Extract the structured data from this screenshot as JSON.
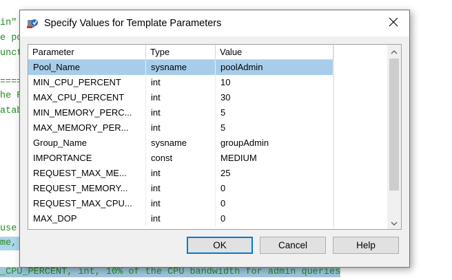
{
  "editor": {
    "lines": [
      {
        "text": "in\""
      },
      {
        "text": "e po"
      },
      {
        "text": "unct"
      },
      {
        "text": ""
      },
      {
        "text": "===="
      },
      {
        "text": "he R"
      },
      {
        "text": "atab"
      },
      {
        "text": "use"
      },
      {
        "text": "me,"
      },
      {
        "text": "_CPU_PERCENT, int, 10% of the CPU bandwidth for admin queries"
      }
    ]
  },
  "dialog": {
    "title": "Specify Values for Template Parameters",
    "columns": [
      "Parameter",
      "Type",
      "Value"
    ],
    "rows": [
      {
        "parameter": "Pool_Name",
        "type": "sysname",
        "value": "poolAdmin"
      },
      {
        "parameter": "MIN_CPU_PERCENT",
        "type": "int",
        "value": "10"
      },
      {
        "parameter": "MAX_CPU_PERCENT",
        "type": "int",
        "value": "30"
      },
      {
        "parameter": "MIN_MEMORY_PERC...",
        "type": "int",
        "value": "5"
      },
      {
        "parameter": "MAX_MEMORY_PER...",
        "type": "int",
        "value": "5"
      },
      {
        "parameter": "Group_Name",
        "type": "sysname",
        "value": "groupAdmin"
      },
      {
        "parameter": "IMPORTANCE",
        "type": "const",
        "value": "MEDIUM"
      },
      {
        "parameter": "REQUEST_MAX_ME...",
        "type": "int",
        "value": "25"
      },
      {
        "parameter": "REQUEST_MEMORY...",
        "type": "int",
        "value": "0"
      },
      {
        "parameter": "REQUEST_MAX_CPU...",
        "type": "int",
        "value": "0"
      },
      {
        "parameter": "MAX_DOP",
        "type": "int",
        "value": "0"
      }
    ],
    "buttons": {
      "ok": "OK",
      "cancel": "Cancel",
      "help": "Help"
    }
  },
  "colors": {
    "selection": "#a8cdea",
    "accent": "#0078d7",
    "code_green": "#228b22"
  }
}
